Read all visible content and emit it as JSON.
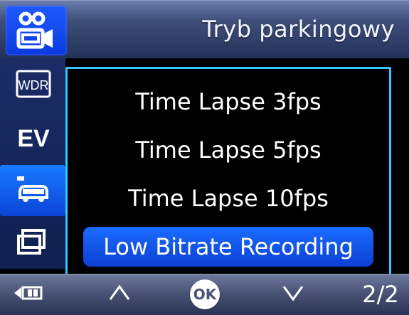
{
  "header": {
    "title": "Tryb parkingowy",
    "icon": "parking-camera-icon"
  },
  "sidebar": {
    "items": [
      {
        "icon": "wdr-icon",
        "label": "WDR"
      },
      {
        "icon": "ev-icon",
        "label": "EV"
      },
      {
        "icon": "parking-car-icon"
      },
      {
        "icon": "screen-toggle-icon"
      }
    ]
  },
  "menu": {
    "items": [
      "Time Lapse 3fps",
      "Time Lapse 5fps",
      "Time Lapse 10fps",
      "Low Bitrate Recording"
    ],
    "selected_index": 3
  },
  "bottom": {
    "back_icon": "back-icon",
    "up_icon": "chevron-up-icon",
    "ok_label": "OK",
    "down_icon": "chevron-down-icon",
    "page": "2/2"
  },
  "colors": {
    "accent": "#1a6cff",
    "panel_border": "#33c6ff",
    "header": "#3f4f7a"
  }
}
